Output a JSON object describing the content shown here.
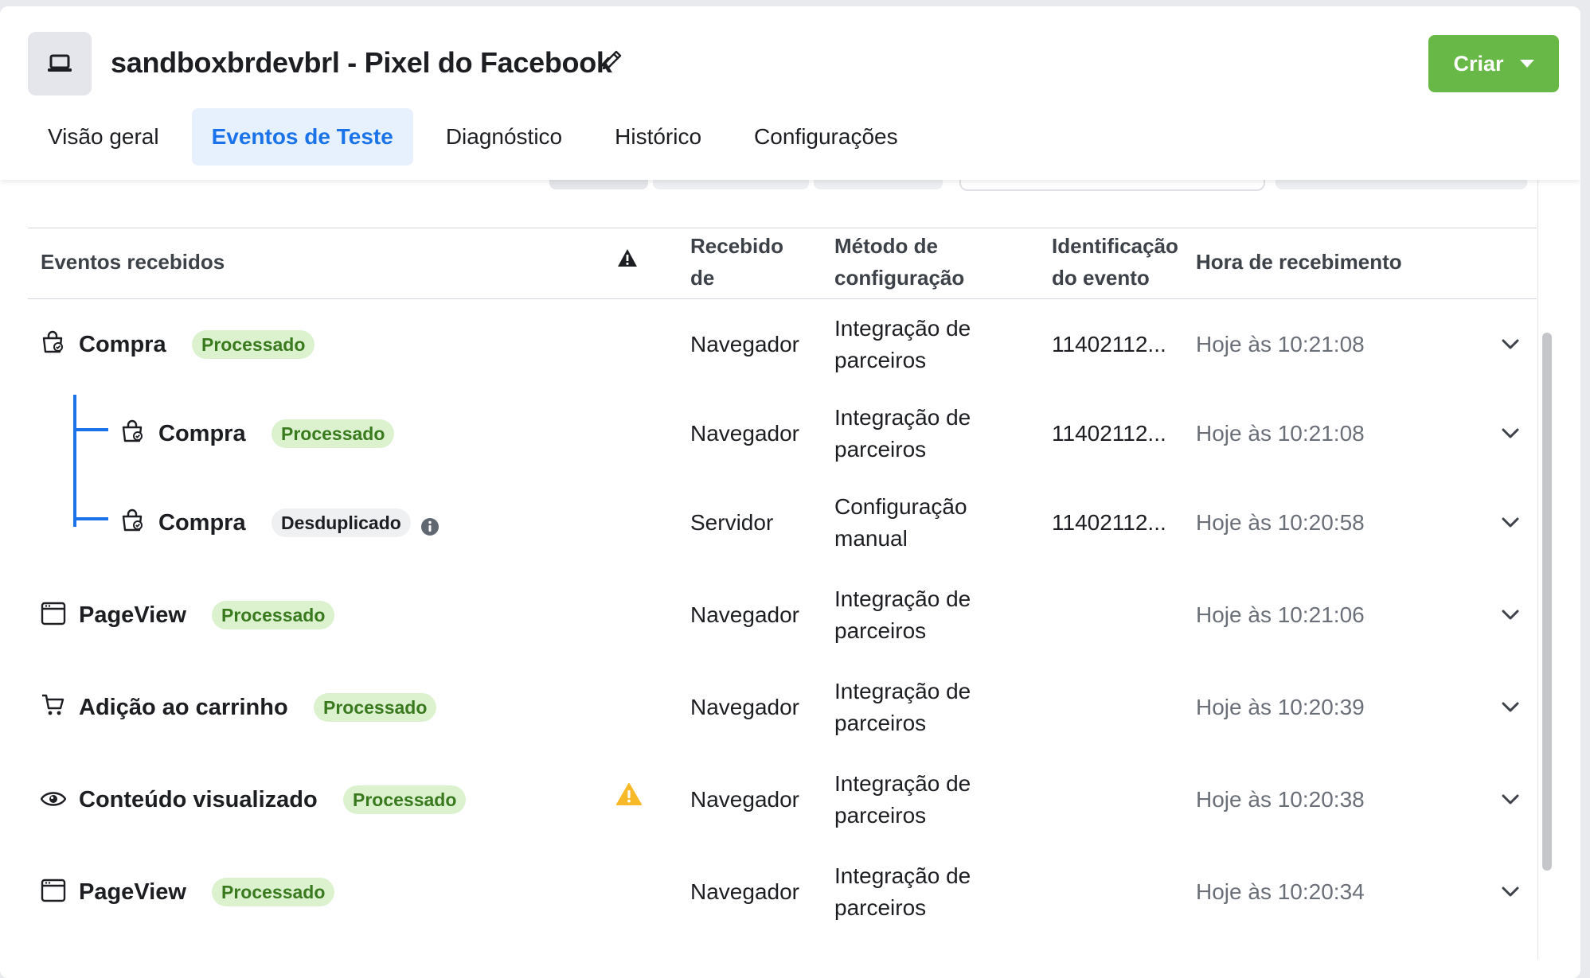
{
  "header": {
    "title": "sandboxbrdevbrl - Pixel do Facebook",
    "create_label": "Criar"
  },
  "tabs": [
    {
      "label": "Visão geral",
      "active": false
    },
    {
      "label": "Eventos de Teste",
      "active": true
    },
    {
      "label": "Diagnóstico",
      "active": false
    },
    {
      "label": "Histórico",
      "active": false
    },
    {
      "label": "Configurações",
      "active": false
    }
  ],
  "table": {
    "columns": {
      "events": "Eventos recebidos",
      "received_from_1": "Recebido",
      "received_from_2": "de",
      "method_1": "Método de",
      "method_2": "configuração",
      "event_id_1": "Identificação",
      "event_id_2": "do evento",
      "time": "Hora de recebimento"
    },
    "rows": [
      {
        "icon": "shopping-bag-icon",
        "name": "Compra",
        "status": "Processado",
        "source": "Navegador",
        "method_1": "Integração de",
        "method_2": "parceiros",
        "event_id": "11402112...",
        "time": "Hoje às 10:21:08"
      },
      {
        "icon": "shopping-bag-icon",
        "name": "Compra",
        "status": "Processado",
        "source": "Navegador",
        "method_1": "Integração de",
        "method_2": "parceiros",
        "event_id": "11402112...",
        "time": "Hoje às 10:21:08"
      },
      {
        "icon": "shopping-bag-icon",
        "name": "Compra",
        "status": "Desduplicado",
        "source": "Servidor",
        "method_1": "Configuração",
        "method_2": "manual",
        "event_id": "11402112...",
        "time": "Hoje às 10:20:58"
      },
      {
        "icon": "browser-window-icon",
        "name": "PageView",
        "status": "Processado",
        "source": "Navegador",
        "method_1": "Integração de",
        "method_2": "parceiros",
        "event_id": "",
        "time": "Hoje às 10:21:06"
      },
      {
        "icon": "shopping-cart-icon",
        "name": "Adição ao carrinho",
        "status": "Processado",
        "source": "Navegador",
        "method_1": "Integração de",
        "method_2": "parceiros",
        "event_id": "",
        "time": "Hoje às 10:20:39"
      },
      {
        "icon": "eye-icon",
        "name": "Conteúdo visualizado",
        "status": "Processado",
        "source": "Navegador",
        "method_1": "Integração de",
        "method_2": "parceiros",
        "event_id": "",
        "time": "Hoje às 10:20:38"
      },
      {
        "icon": "browser-window-icon",
        "name": "PageView",
        "status": "Processado",
        "source": "Navegador",
        "method_1": "Integração de",
        "method_2": "parceiros",
        "event_id": "",
        "time": "Hoje às 10:20:34"
      }
    ]
  },
  "colors": {
    "accent_blue": "#1a73e8",
    "create_green": "#67b847",
    "badge_green_bg": "#dcf2cf",
    "badge_green_text": "#3a7a1f",
    "warning_yellow": "#f7b928"
  }
}
